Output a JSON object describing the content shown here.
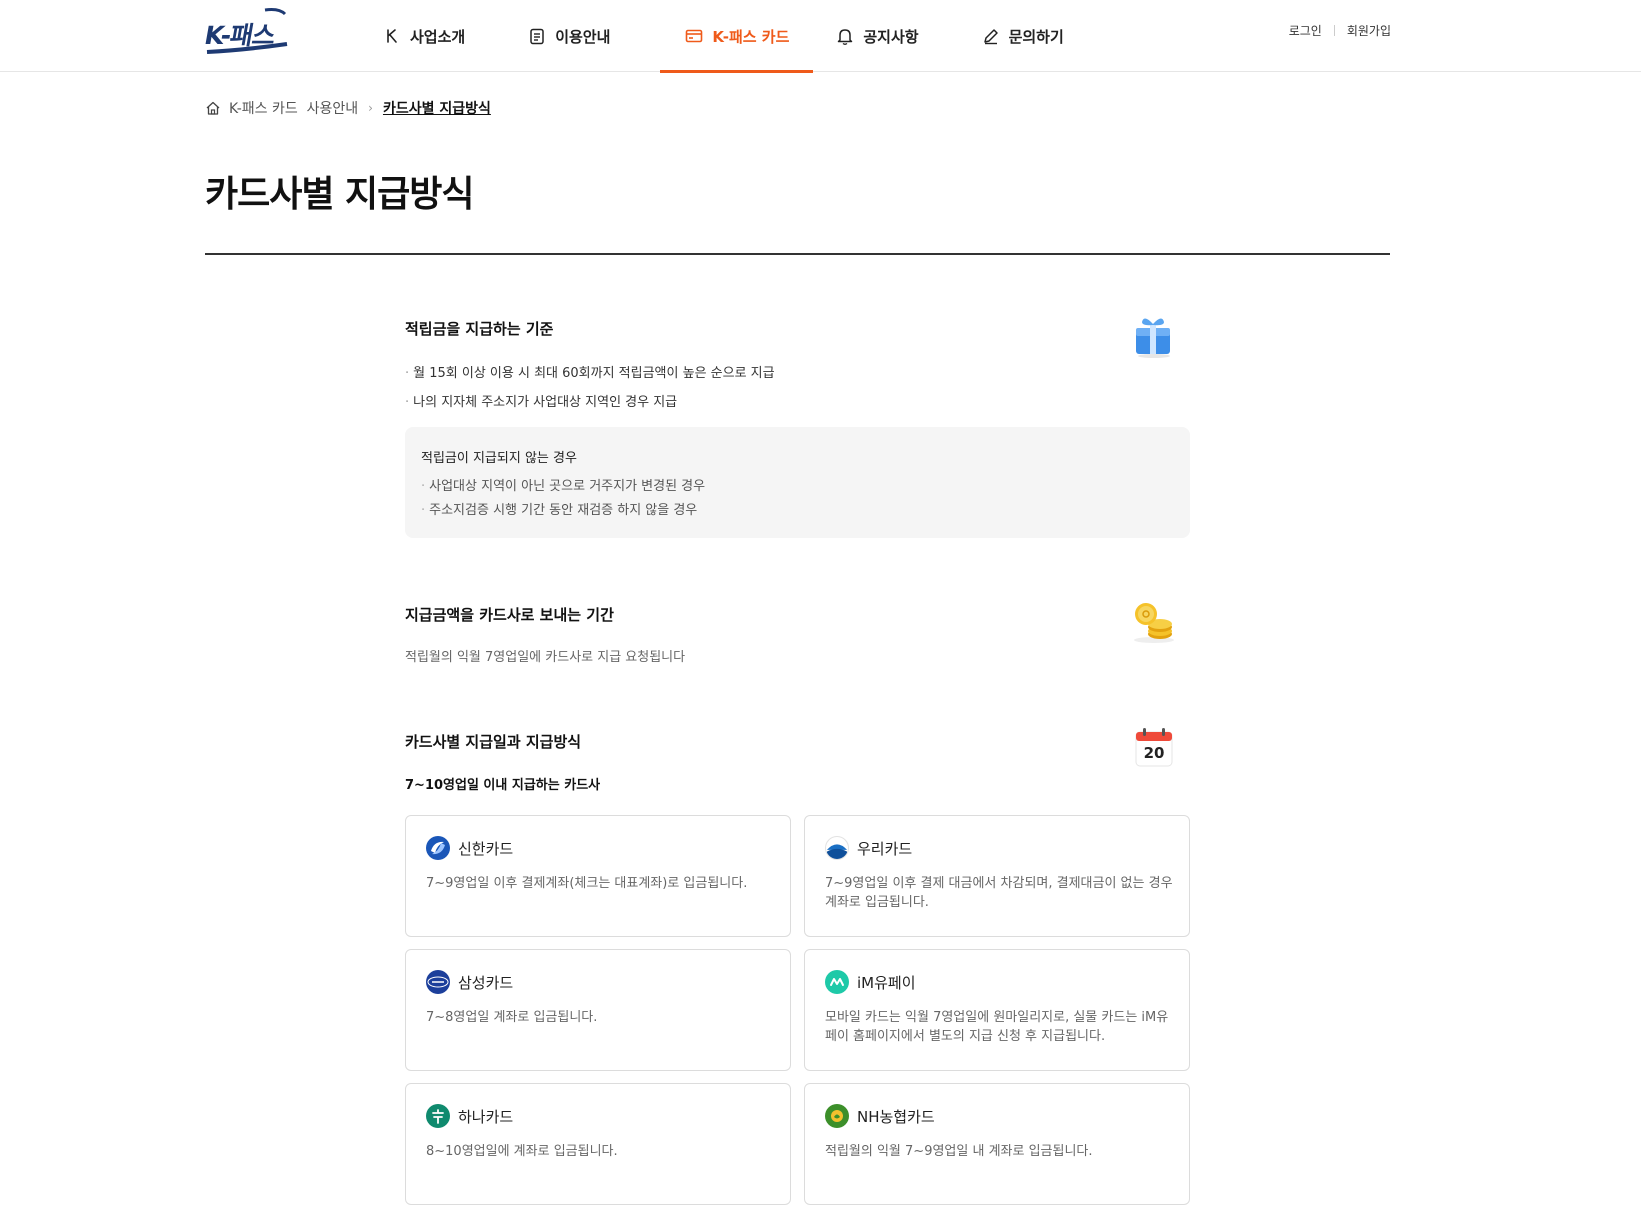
{
  "header": {
    "logo_text": "K-패스",
    "nav": [
      {
        "label": "사업소개"
      },
      {
        "label": "이용안내"
      },
      {
        "label": "K-패스 카드"
      },
      {
        "label": "공지사항"
      },
      {
        "label": "문의하기"
      }
    ],
    "active_nav": 2,
    "login": "로그인",
    "signup": "회원가입"
  },
  "breadcrumb": {
    "parent": "K-패스 카드  사용안내",
    "current": "카드사별 지급방식"
  },
  "page_title": "카드사별 지급방식",
  "criteria": {
    "title": "적립금을 지급하는 기준",
    "bullets": [
      "월 15회 이상 이용 시 최대 60회까지 적립금액이 높은 순으로 지급",
      "나의 지자체 주소지가 사업대상 지역인 경우 지급"
    ],
    "exception_title": "적립금이 지급되지 않는 경우",
    "exceptions": [
      "사업대상 지역이 아닌 곳으로 거주지가 변경된 경우",
      "주소지검증 시행 기간 동안 재검증 하지 않을 경우"
    ]
  },
  "period": {
    "title": "지급금액을 카드사로 보내는 기간",
    "text": "적립월의 익월 7영업일에 카드사로 지급 요청됩니다"
  },
  "methods": {
    "title": "카드사별 지급일과 지급방식",
    "calendar_day": "20",
    "group_title": "7~10영업일 이내 지급하는 카드사",
    "cards": [
      {
        "name": "신한카드",
        "desc": "7~9영업일 이후 결제계좌(체크는 대표계좌)로 입금됩니다.",
        "color": "#1a56b8"
      },
      {
        "name": "우리카드",
        "desc": "7~9영업일 이후 결제 대금에서 차감되며, 결제대금이 없는 경우 계좌로 입금됩니다.",
        "color": "#1a6fc4"
      },
      {
        "name": "삼성카드",
        "desc": "7~8영업일 계좌로 입금됩니다.",
        "color": "#1c3f9b"
      },
      {
        "name": "iM유페이",
        "desc": "모바일 카드는 익월 7영업일에 원마일리지로, 실물 카드는 iM유페이 홈페이지에서 별도의 지급 신청 후 지급됩니다.",
        "color": "#1ec9a8"
      },
      {
        "name": "하나카드",
        "desc": "8~10영업일에 계좌로 입금됩니다.",
        "color": "#0f8a6e"
      },
      {
        "name": "NH농협카드",
        "desc": "적립월의 익월 7~9영업일 내 계좌로 입금됩니다.",
        "color": "#3c8f2a"
      }
    ]
  },
  "colors": {
    "accent": "#ef5a1a",
    "brand": "#1e3a73"
  }
}
